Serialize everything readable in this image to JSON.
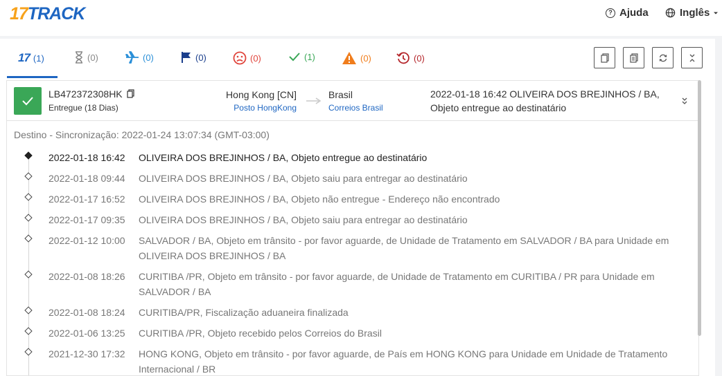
{
  "header": {
    "logo_num": "17",
    "logo_text": "TRACK",
    "help_label": "Ajuda",
    "language_label": "Inglês"
  },
  "tabs": [
    {
      "id": "all",
      "count": "(1)",
      "color": "#1e66c2"
    },
    {
      "id": "pending",
      "count": "(0)",
      "color": "#888888"
    },
    {
      "id": "in-transit",
      "count": "(0)",
      "color": "#2a8fd8"
    },
    {
      "id": "pickup",
      "count": "(0)",
      "color": "#1a3e8c"
    },
    {
      "id": "undelivered",
      "count": "(0)",
      "color": "#e0443b"
    },
    {
      "id": "delivered",
      "count": "(1)",
      "color": "#3aa757"
    },
    {
      "id": "alert",
      "count": "(0)",
      "color": "#f07d1c"
    },
    {
      "id": "expired",
      "count": "(0)",
      "color": "#b5262b"
    }
  ],
  "shipment": {
    "tracking_number": "LB472372308HK",
    "status": "Entregue (18 Dias)",
    "origin": "Hong Kong [CN]",
    "origin_carrier": "Posto HongKong",
    "destination": "Brasil",
    "destination_carrier": "Correios Brasil",
    "latest_event": "2022-01-18 16:42  OLIVEIRA DOS BREJINHOS / BA, Objeto entregue ao destinatário",
    "status_color": "#3aa757"
  },
  "sync_text": "Destino - Sincronização: 2022-01-24 13:07:34 (GMT-03:00)",
  "events": [
    {
      "date": "2022-01-18 16:42",
      "desc": "OLIVEIRA DOS BREJINHOS / BA, Objeto entregue ao destinatário"
    },
    {
      "date": "2022-01-18 09:44",
      "desc": "OLIVEIRA DOS BREJINHOS / BA, Objeto saiu para entregar ao destinatário"
    },
    {
      "date": "2022-01-17 16:52",
      "desc": "OLIVEIRA DOS BREJINHOS / BA, Objeto não entregue - Endereço não encontrado"
    },
    {
      "date": "2022-01-17 09:35",
      "desc": "OLIVEIRA DOS BREJINHOS / BA, Objeto saiu para entregar ao destinatário"
    },
    {
      "date": "2022-01-12 10:00",
      "desc": "SALVADOR / BA, Objeto em trânsito - por favor aguarde, de Unidade de Tratamento em SALVADOR / BA para Unidade em OLIVEIRA DOS BREJINHOS / BA"
    },
    {
      "date": "2022-01-08 18:26",
      "desc": "CURITIBA /PR, Objeto em trânsito - por favor aguarde, de Unidade de Tratamento em CURITIBA / PR para Unidade em SALVADOR / BA"
    },
    {
      "date": "2022-01-08 18:24",
      "desc": "CURITIBA/PR, Fiscalização aduaneira finalizada"
    },
    {
      "date": "2022-01-06 13:25",
      "desc": "CURITIBA /PR, Objeto recebido pelos Correios do Brasil"
    },
    {
      "date": "2021-12-30 17:32",
      "desc": "HONG KONG, Objeto em trânsito - por favor aguarde, de País em HONG KONG para Unidade em Unidade de Tratamento Internacional / BR"
    }
  ]
}
